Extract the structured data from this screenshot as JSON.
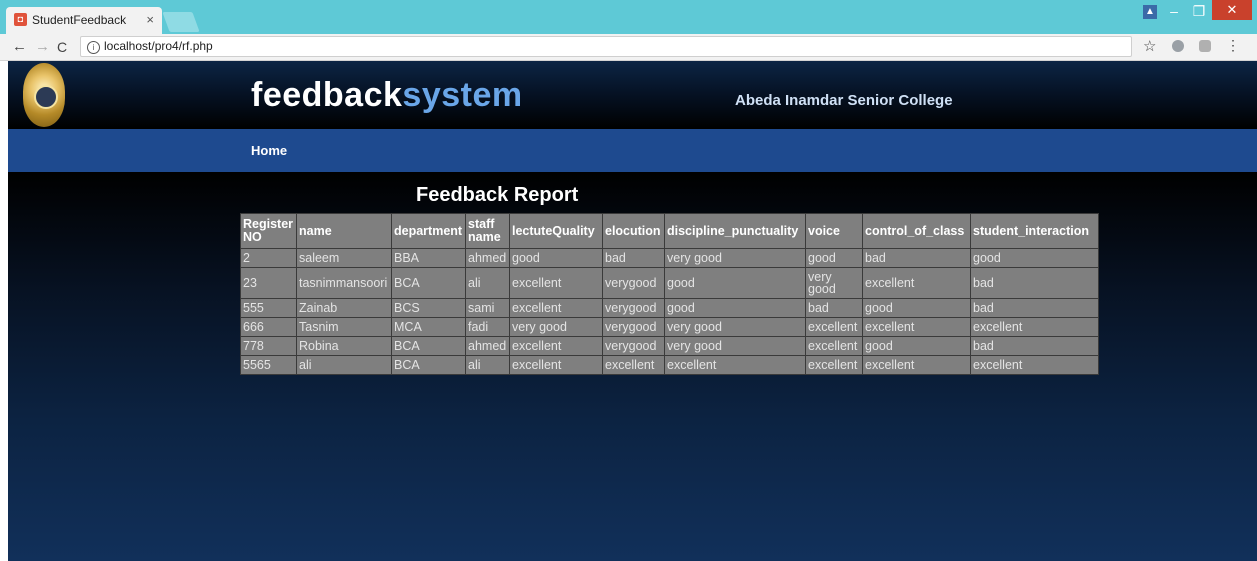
{
  "browser": {
    "tab_title": "StudentFeedback",
    "tab_close": "×",
    "url": "localhost/pro4/rf.php"
  },
  "site": {
    "brand_part1": "feedback",
    "brand_part2": "system",
    "college": "Abeda Inamdar Senior College",
    "nav_home": "Home"
  },
  "report": {
    "title": "Feedback Report",
    "columns": [
      "Register NO",
      "name",
      "department",
      "staff name",
      "lectuteQuality",
      "elocution",
      "discipline_punctuality",
      "voice",
      "control_of_class",
      "student_interaction"
    ],
    "rows": [
      [
        "2",
        "saleem",
        "BBA",
        "ahmed",
        "good",
        "bad",
        "very good",
        "good",
        "bad",
        "good"
      ],
      [
        "23",
        "tasnimmansoori",
        "BCA",
        "ali",
        "excellent",
        "verygood",
        "good",
        "very good",
        "excellent",
        "bad"
      ],
      [
        "555",
        "Zainab",
        "BCS",
        "sami",
        "excellent",
        "verygood",
        "good",
        "bad",
        "good",
        "bad"
      ],
      [
        "666",
        "Tasnim",
        "MCA",
        "fadi",
        "very good",
        "verygood",
        "very good",
        "excellent",
        "excellent",
        "excellent"
      ],
      [
        "778",
        "Robina",
        "BCA",
        "ahmed",
        "excellent",
        "verygood",
        "very good",
        "excellent",
        "good",
        "bad"
      ],
      [
        "5565",
        "ali",
        "BCA",
        "ali",
        "excellent",
        "excellent",
        "excellent",
        "excellent",
        "excellent",
        "excellent"
      ]
    ]
  }
}
